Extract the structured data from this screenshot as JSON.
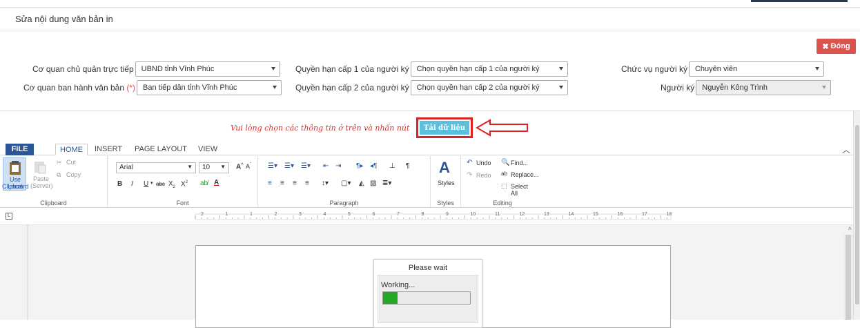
{
  "dialog": {
    "title": "Sửa nội dung văn bản in",
    "close_label": "Đóng"
  },
  "form": {
    "co_quan_chu_quan": {
      "label": "Cơ quan chủ quản trực tiếp",
      "value": "UBND tỉnh Vĩnh Phúc"
    },
    "co_quan_ban_hanh": {
      "label": "Cơ quan ban hành văn bản",
      "required_mark": "(*)",
      "value": "Ban tiếp dân tỉnh Vĩnh Phúc"
    },
    "quyen_han_1": {
      "label": "Quyền hạn cấp 1 của người ký",
      "value": "Chọn quyền hạn cấp 1 của người ký"
    },
    "quyen_han_2": {
      "label": "Quyền hạn cấp 2 của người ký",
      "value": "Chọn quyền hạn cấp 2 của người ký"
    },
    "chuc_vu": {
      "label": "Chức vụ người ký",
      "value": "Chuyên viên"
    },
    "nguoi_ky": {
      "label": "Người ký",
      "value": "Nguyễn Kông Trình"
    }
  },
  "notice": "Vui lòng chọn các thông tin ở trên và nhấn nút",
  "load_button": "Tải dữ liệu",
  "ribbon": {
    "tabs": [
      "FILE",
      "HOME",
      "INSERT",
      "PAGE LAYOUT",
      "VIEW"
    ],
    "clipboard": {
      "use_local": "Use Local",
      "use_local2": "Clipboard",
      "paste": "Paste",
      "paste2": "(Server)",
      "cut": "Cut",
      "copy": "Copy",
      "group": "Clipboard"
    },
    "font": {
      "family": "Arial",
      "size": "10",
      "group": "Font"
    },
    "paragraph": {
      "group": "Paragraph"
    },
    "styles": {
      "label": "Styles",
      "group": "Styles"
    },
    "editing": {
      "undo": "Undo",
      "redo": "Redo",
      "find": "Find...",
      "replace": "Replace...",
      "select_all": "Select All",
      "group": "Editing"
    }
  },
  "ruler_marks": [
    "2",
    "1",
    "1",
    "2",
    "3",
    "4",
    "5",
    "6",
    "7",
    "8",
    "9",
    "10",
    "11",
    "12",
    "13",
    "14",
    "15",
    "16",
    "17",
    "18"
  ],
  "wait_dialog": {
    "title": "Please wait",
    "status": "Working...",
    "progress": 0.17
  },
  "colors": {
    "accent": "#2b579a",
    "danger": "#d9534f",
    "info": "#5bc0de",
    "progress": "#26a826"
  }
}
